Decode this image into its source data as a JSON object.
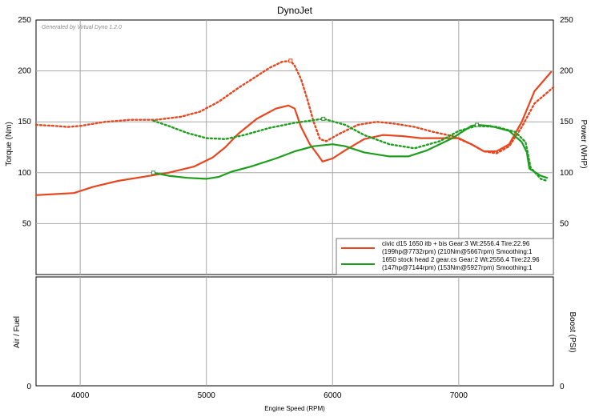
{
  "chart_data": {
    "type": "line",
    "title": "DynoJet",
    "watermark": "Generated by Virtual Dyno 1.2.0",
    "xlabel": "Engine Speed (RPM)",
    "ylabel_left": "Torque (Nm)",
    "ylabel_right": "Power (WHP)",
    "xlim": [
      3650,
      7750
    ],
    "ylim": [
      0,
      250
    ],
    "x_ticks": [
      4000,
      5000,
      6000,
      7000
    ],
    "y_ticks": [
      50,
      100,
      150,
      200,
      250
    ],
    "grid": true,
    "legend_position": "bottom-right",
    "series": [
      {
        "name": "civic d15  1650 itb + bis Gear:3 Wt:2556.4 Tire:22.96 (199hp@7732rpm) (210Nm@5667rpm) Smoothing:1",
        "color": "#e8461e",
        "measure": "torque",
        "style": "dotted",
        "x": [
          3650,
          3800,
          3900,
          4000,
          4200,
          4400,
          4600,
          4800,
          4950,
          5100,
          5250,
          5400,
          5500,
          5600,
          5667,
          5700,
          5750,
          5800,
          5850,
          5900,
          5950,
          6050,
          6200,
          6350,
          6500,
          6650,
          6800,
          6950,
          7100,
          7200,
          7300,
          7400,
          7500,
          7600,
          7750
        ],
        "y": [
          147,
          146,
          145,
          146,
          150,
          152,
          152,
          155,
          160,
          170,
          183,
          195,
          203,
          209,
          210,
          205,
          192,
          172,
          150,
          133,
          131,
          138,
          147,
          150,
          148,
          145,
          140,
          136,
          128,
          121,
          119,
          126,
          145,
          168,
          184
        ]
      },
      {
        "name": "civic d15  1650 itb + bis Gear:3 Wt:2556.4 Tire:22.96 (199hp@7732rpm) (210Nm@5667rpm) Smoothing:1",
        "color": "#e8461e",
        "measure": "power",
        "style": "solid",
        "x": [
          3650,
          3800,
          3950,
          4100,
          4300,
          4500,
          4700,
          4900,
          5050,
          5150,
          5250,
          5400,
          5550,
          5650,
          5700,
          5750,
          5820,
          5880,
          5920,
          6000,
          6100,
          6250,
          6400,
          6550,
          6700,
          6850,
          7000,
          7100,
          7200,
          7300,
          7400,
          7500,
          7600,
          7732
        ],
        "y": [
          78,
          79,
          80,
          86,
          92,
          96,
          100,
          106,
          115,
          125,
          138,
          153,
          163,
          166,
          163,
          145,
          128,
          118,
          111,
          114,
          122,
          133,
          137,
          136,
          134,
          134,
          134,
          128,
          121,
          121,
          128,
          150,
          180,
          199
        ]
      },
      {
        "name": "1650 stock head 2 gear.cs Gear:2 Wt:2556.4 Tire:22.96 (147hp@7144rpm) (153Nm@5927rpm) Smoothing:1",
        "color": "#1e9e1e",
        "measure": "torque",
        "style": "dotted",
        "x": [
          4580,
          4700,
          4850,
          5000,
          5150,
          5300,
          5500,
          5700,
          5927,
          6100,
          6250,
          6450,
          6650,
          6850,
          7000,
          7144,
          7300,
          7450,
          7530,
          7570,
          7650,
          7700
        ],
        "y": [
          151,
          146,
          139,
          134,
          133,
          137,
          144,
          149,
          153,
          147,
          137,
          128,
          124,
          131,
          141,
          146,
          145,
          140,
          130,
          105,
          94,
          92
        ]
      },
      {
        "name": "1650 stock head 2 gear.cs Gear:2 Wt:2556.4 Tire:22.96 (147hp@7144rpm) (153Nm@5927rpm) Smoothing:1",
        "color": "#1e9e1e",
        "measure": "power",
        "style": "solid",
        "x": [
          4580,
          4700,
          4850,
          5000,
          5100,
          5200,
          5350,
          5550,
          5700,
          5850,
          6000,
          6100,
          6250,
          6450,
          6600,
          6750,
          6950,
          7100,
          7144,
          7250,
          7400,
          7500,
          7540,
          7560,
          7650,
          7700
        ],
        "y": [
          100,
          97,
          95,
          94,
          96,
          101,
          106,
          114,
          121,
          126,
          128,
          126,
          120,
          116,
          116,
          122,
          134,
          146,
          147,
          146,
          141,
          130,
          120,
          104,
          97,
          95
        ]
      }
    ],
    "markers": [
      {
        "x": 5667,
        "y": 210,
        "color": "#e8461e"
      },
      {
        "x": 5927,
        "y": 153,
        "color": "#1e9e1e"
      },
      {
        "x": 7144,
        "y": 147,
        "color": "#1e9e1e"
      },
      {
        "x": 4580,
        "y": 100,
        "color": "#1e9e1e"
      }
    ],
    "lower_panel": {
      "ylabel_left": "Air / Fuel",
      "ylabel_right": "Boost (PSI)",
      "tick_left": "0",
      "tick_right": "0"
    }
  },
  "legend": [
    {
      "line1": "civic d15  1650 itb + bis Gear:3 Wt:2556.4 Tire:22.96",
      "line2": "(199hp@7732rpm) (210Nm@5667rpm) Smoothing:1",
      "color": "#e8461e"
    },
    {
      "line1": "1650 stock head 2 gear.cs Gear:2 Wt:2556.4 Tire:22.96",
      "line2": "(147hp@7144rpm) (153Nm@5927rpm) Smoothing:1",
      "color": "#1e9e1e"
    }
  ]
}
